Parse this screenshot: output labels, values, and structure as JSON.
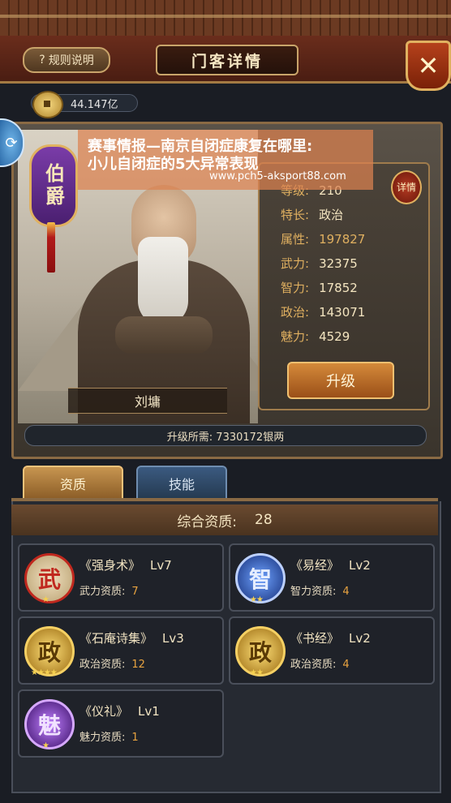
{
  "header": {
    "rules_label": "规则说明",
    "title": "门客详情",
    "close_glyph": "✕"
  },
  "currency": {
    "amount": "44.147亿"
  },
  "hero": {
    "rank": "伯爵",
    "name": "刘墉",
    "detail_label": "详情",
    "stats": [
      {
        "label": "等级:",
        "value": "210"
      },
      {
        "label": "特长:",
        "value": "政治"
      },
      {
        "label": "属性:",
        "value": "197827"
      },
      {
        "label": "武力:",
        "value": "32375"
      },
      {
        "label": "智力:",
        "value": "17852"
      },
      {
        "label": "政治:",
        "value": "143071"
      },
      {
        "label": "魅力:",
        "value": "4529"
      }
    ],
    "upgrade_label": "升级",
    "upgrade_cost": "升级所需: 7330172银两"
  },
  "overlay": {
    "line1": "赛事情报—南京自闭症康复在哪里:",
    "line2": "小儿自闭症的5大异常表现",
    "url": "www.pch5-aksport88.com"
  },
  "tabs": [
    {
      "label": "资质",
      "active": true
    },
    {
      "label": "技能",
      "active": false
    }
  ],
  "summary": {
    "label": "综合资质:",
    "value": "28"
  },
  "skills": [
    {
      "icon_char": "武",
      "icon": "martial-icon",
      "name": "《强身术》",
      "level": "Lv7",
      "attr": "武力资质:",
      "value": "7",
      "stars": "★",
      "color": "#c0281e"
    },
    {
      "icon_char": "智",
      "icon": "wisdom-icon",
      "name": "《易经》",
      "level": "Lv2",
      "attr": "智力资质:",
      "value": "4",
      "stars": "★★",
      "color": "#2f5fd0"
    },
    {
      "icon_char": "政",
      "icon": "politics-icon",
      "name": "《石庵诗集》",
      "level": "Lv3",
      "attr": "政治资质:",
      "value": "12",
      "stars": "★★★★",
      "color": "#d9a21e"
    },
    {
      "icon_char": "政",
      "icon": "politics-icon",
      "name": "《书经》",
      "level": "Lv2",
      "attr": "政治资质:",
      "value": "4",
      "stars": "★★",
      "color": "#d9a21e"
    },
    {
      "icon_char": "魅",
      "icon": "charm-icon",
      "name": "《仪礼》",
      "level": "Lv1",
      "attr": "魅力资质:",
      "value": "1",
      "stars": "★",
      "color": "#8a36c8"
    }
  ]
}
